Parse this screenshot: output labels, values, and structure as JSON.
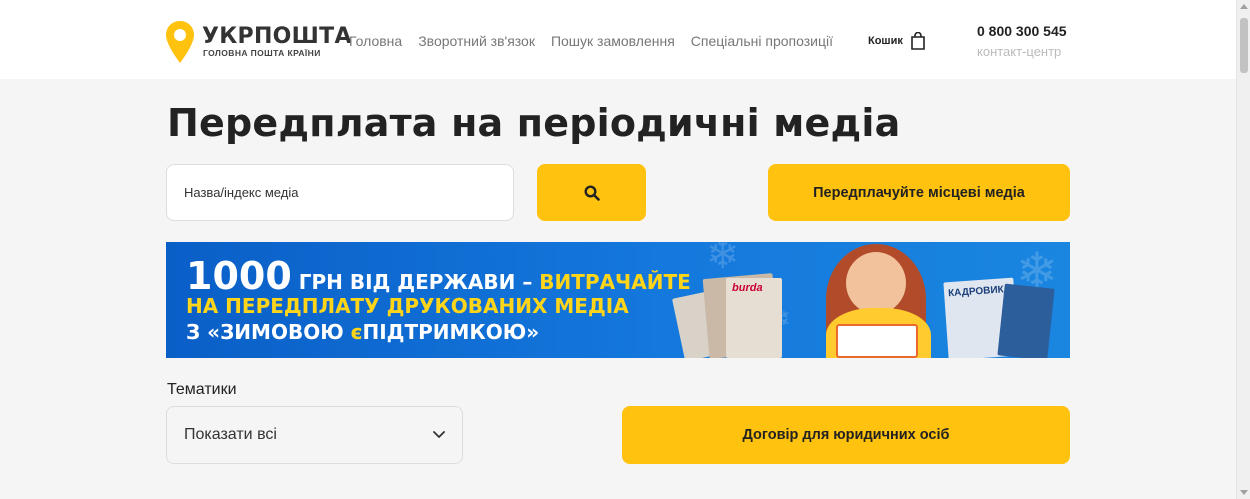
{
  "header": {
    "logo_title": "УКРПОШТА",
    "logo_subtitle": "ГОЛОВНА ПОШТА КРАЇНИ",
    "nav": [
      {
        "label": "Головна"
      },
      {
        "label": "Зворотний зв'язок"
      },
      {
        "label": "Пошук замовлення"
      },
      {
        "label": "Спеціальні пропозиції"
      }
    ],
    "cart_label": "Кошик",
    "cart_icon": "shopping-bag-icon",
    "phone": "0 800 300 545",
    "phone_caption": "контакт-центр"
  },
  "main": {
    "title": "Передплата на періодичні медіа",
    "search": {
      "placeholder": "Назва/індекс медіа",
      "value": "",
      "button_icon": "search-icon"
    },
    "local_media_button": "Передплачуйте місцеві медіа",
    "banner": {
      "line1_big": "1000",
      "line1_rest": " ГРН ВІД ДЕРЖАВИ – ",
      "line1_highlight": "ВИТРАЧАЙТЕ",
      "line2": "НА ПЕРЕДПЛАТУ ДРУКОВАНИХ МЕДІА",
      "line3_prefix": "З «ЗИМОВОЮ ",
      "line3_e": "є",
      "line3_suffix": "ПІДТРИМКОЮ»",
      "magazine_1": "burda",
      "magazine_2": "КАДРОВИК"
    },
    "themes": {
      "label": "Тематики",
      "selected": "Показати всі",
      "icon": "chevron-down-icon"
    },
    "contract_button": "Договір для юридичних осіб"
  },
  "colors": {
    "accent": "#ffc20e",
    "banner_blue": "#0a5fc7",
    "banner_yellow": "#ffd51a"
  }
}
